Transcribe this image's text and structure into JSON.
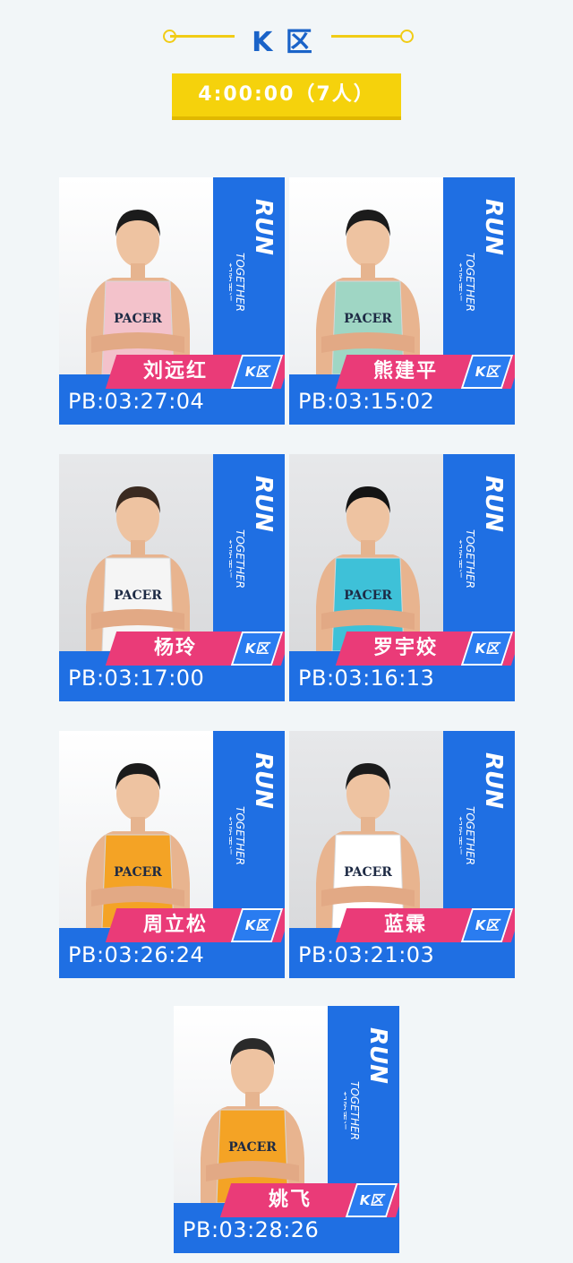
{
  "header": {
    "zone_title": "K 区",
    "time_banner": "4:00:00（7人）"
  },
  "card_common": {
    "run_word": "RUN",
    "together_word": "TOGETHER",
    "slogan": "一起跑更远",
    "zone_tag": "K区",
    "shirt_text": "PACER"
  },
  "pacers": [
    {
      "name": "刘远红",
      "pb": "PB:03:27:04",
      "shirt": "#f3c2cb",
      "hair": "#1b1b1b",
      "bg": "white"
    },
    {
      "name": "熊建平",
      "pb": "PB:03:15:02",
      "shirt": "#9fd6c4",
      "hair": "#1b1b1b",
      "bg": "white"
    },
    {
      "name": "杨玲",
      "pb": "PB:03:17:00",
      "shirt": "#f5f5f5",
      "hair": "#3a2a20",
      "bg": "grey"
    },
    {
      "name": "罗宇姣",
      "pb": "PB:03:16:13",
      "shirt": "#3ec1d8",
      "hair": "#141414",
      "bg": "grey"
    },
    {
      "name": "周立松",
      "pb": "PB:03:26:24",
      "shirt": "#f4a325",
      "hair": "#1b1b1b",
      "bg": "white"
    },
    {
      "name": "蓝霖",
      "pb": "PB:03:21:03",
      "shirt": "#ffffff",
      "hair": "#1b1b1b",
      "bg": "grey"
    },
    {
      "name": "姚飞",
      "pb": "PB:03:28:26",
      "shirt": "#f4a325",
      "hair": "#2a2a2a",
      "bg": "white"
    }
  ],
  "colors": {
    "accent_yellow": "#f5d20c",
    "brand_blue": "#1f6fe3",
    "name_pink": "#ea3b78"
  }
}
